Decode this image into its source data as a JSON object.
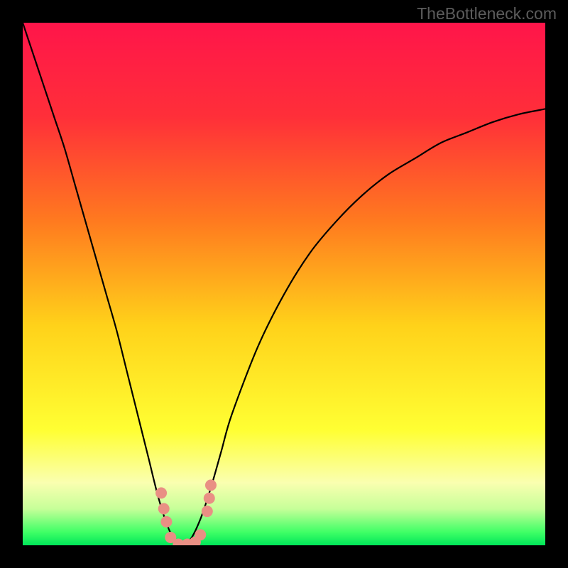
{
  "watermark": "TheBottleneck.com",
  "chart_data": {
    "type": "line",
    "title": "",
    "xlabel": "",
    "ylabel": "",
    "xrange": [
      0,
      100
    ],
    "yrange": [
      0,
      100
    ],
    "gradient_stops": [
      {
        "offset": 0.0,
        "color": "#ff154a"
      },
      {
        "offset": 0.18,
        "color": "#ff2f39"
      },
      {
        "offset": 0.38,
        "color": "#ff7a1f"
      },
      {
        "offset": 0.58,
        "color": "#ffd21a"
      },
      {
        "offset": 0.78,
        "color": "#ffff33"
      },
      {
        "offset": 0.88,
        "color": "#faffb0"
      },
      {
        "offset": 0.93,
        "color": "#c7ff99"
      },
      {
        "offset": 0.975,
        "color": "#3fff66"
      },
      {
        "offset": 1.0,
        "color": "#00e659"
      }
    ],
    "curve": {
      "comment": "Approximate bottleneck-style V curve. y is mismatch percent (0 at optimum).",
      "x": [
        0,
        2,
        4,
        6,
        8,
        10,
        12,
        14,
        16,
        18,
        20,
        22,
        24,
        26,
        28,
        30,
        32,
        34,
        36,
        38,
        40,
        45,
        50,
        55,
        60,
        65,
        70,
        75,
        80,
        85,
        90,
        95,
        100
      ],
      "y": [
        100,
        94,
        88,
        82,
        76,
        69,
        62,
        55,
        48,
        41,
        33,
        25,
        17,
        9,
        3,
        0,
        1,
        5,
        11,
        18,
        25,
        38,
        48,
        56,
        62,
        67,
        71,
        74,
        77,
        79,
        81,
        82.5,
        83.5
      ]
    },
    "markers": {
      "comment": "Small salmon markers near the valley floor",
      "points": [
        {
          "x": 26.5,
          "y": 10
        },
        {
          "x": 27.0,
          "y": 7
        },
        {
          "x": 27.5,
          "y": 4.5
        },
        {
          "x": 28.3,
          "y": 1.5
        },
        {
          "x": 29.8,
          "y": 0.2
        },
        {
          "x": 31.5,
          "y": 0.2
        },
        {
          "x": 33.0,
          "y": 0.6
        },
        {
          "x": 34.0,
          "y": 2.0
        },
        {
          "x": 35.3,
          "y": 6.5
        },
        {
          "x": 35.7,
          "y": 9.0
        },
        {
          "x": 36.0,
          "y": 11.5
        }
      ],
      "color": "#e98f84",
      "radius_px": 8
    }
  }
}
